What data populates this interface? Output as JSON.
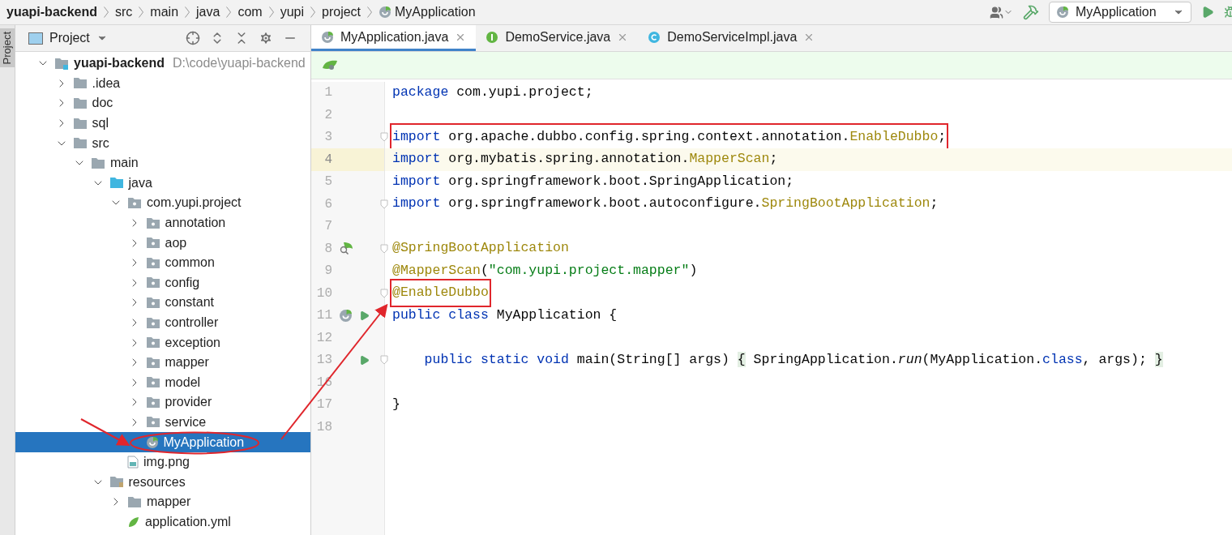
{
  "breadcrumbs": [
    "yuapi-backend",
    "src",
    "main",
    "java",
    "com",
    "yupi",
    "project",
    "MyApplication"
  ],
  "run_config": {
    "label": "MyApplication"
  },
  "side_tab": {
    "label": "Project",
    "selected": true
  },
  "project_panel": {
    "title": "Project",
    "tree": [
      {
        "label": "yuapi-backend",
        "kind": "module",
        "path": "D:\\code\\yuapi-backend",
        "expanded": true,
        "selected": false,
        "children": [
          {
            "label": ".idea",
            "kind": "folder",
            "expanded": false,
            "selected": false
          },
          {
            "label": "doc",
            "kind": "folder",
            "expanded": false,
            "selected": false
          },
          {
            "label": "sql",
            "kind": "folder",
            "expanded": false,
            "selected": false
          },
          {
            "label": "src",
            "kind": "folder",
            "expanded": true,
            "selected": false,
            "children": [
              {
                "label": "main",
                "kind": "folder",
                "expanded": true,
                "selected": false,
                "children": [
                  {
                    "label": "java",
                    "kind": "source",
                    "expanded": true,
                    "selected": false,
                    "children": [
                      {
                        "label": "com.yupi.project",
                        "kind": "package",
                        "expanded": true,
                        "selected": false,
                        "children": [
                          {
                            "label": "annotation",
                            "kind": "package",
                            "expanded": false,
                            "selected": false
                          },
                          {
                            "label": "aop",
                            "kind": "package",
                            "expanded": false,
                            "selected": false
                          },
                          {
                            "label": "common",
                            "kind": "package",
                            "expanded": false,
                            "selected": false
                          },
                          {
                            "label": "config",
                            "kind": "package",
                            "expanded": false,
                            "selected": false
                          },
                          {
                            "label": "constant",
                            "kind": "package",
                            "expanded": false,
                            "selected": false
                          },
                          {
                            "label": "controller",
                            "kind": "package",
                            "expanded": false,
                            "selected": false
                          },
                          {
                            "label": "exception",
                            "kind": "package",
                            "expanded": false,
                            "selected": false
                          },
                          {
                            "label": "mapper",
                            "kind": "package",
                            "expanded": false,
                            "selected": false
                          },
                          {
                            "label": "model",
                            "kind": "package",
                            "expanded": false,
                            "selected": false
                          },
                          {
                            "label": "provider",
                            "kind": "package",
                            "expanded": false,
                            "selected": false
                          },
                          {
                            "label": "service",
                            "kind": "package",
                            "expanded": false,
                            "selected": false
                          },
                          {
                            "label": "MyApplication",
                            "kind": "spring-class",
                            "selected": true,
                            "circled": true
                          }
                        ]
                      },
                      {
                        "label": "img.png",
                        "kind": "image",
                        "selected": false
                      }
                    ]
                  },
                  {
                    "label": "resources",
                    "kind": "resources",
                    "expanded": true,
                    "selected": false,
                    "children": [
                      {
                        "label": "mapper",
                        "kind": "folder",
                        "expanded": false,
                        "selected": false
                      },
                      {
                        "label": "application.yml",
                        "kind": "yaml",
                        "selected": false
                      }
                    ]
                  }
                ]
              }
            ]
          }
        ]
      }
    ]
  },
  "tabs": [
    {
      "label": "MyApplication.java",
      "kind": "spring-class",
      "selected": true
    },
    {
      "label": "DemoService.java",
      "kind": "interface",
      "selected": false
    },
    {
      "label": "DemoServiceImpl.java",
      "kind": "class",
      "selected": false
    }
  ],
  "code": [
    {
      "number": "1",
      "tokens": [
        {
          "text": "package",
          "kind": "kw"
        },
        {
          "text": " com.yupi.project;",
          "kind": "plain"
        }
      ]
    },
    {
      "number": "2"
    },
    {
      "number": "3",
      "fold": true,
      "boxed": true,
      "tokens": [
        {
          "text": "import",
          "kind": "kw"
        },
        {
          "text": " org.apache.dubbo.config.spring.context.annotation.",
          "kind": "plain"
        },
        {
          "text": "EnableDubbo",
          "kind": "ann"
        },
        {
          "text": ";",
          "kind": "plain"
        }
      ]
    },
    {
      "number": "4",
      "current": true,
      "tokens": [
        {
          "text": "import",
          "kind": "kw"
        },
        {
          "text": " org.mybatis.spring.annotation.",
          "kind": "plain"
        },
        {
          "text": "MapperScan",
          "kind": "ann"
        },
        {
          "text": ";",
          "kind": "plain"
        }
      ]
    },
    {
      "number": "5",
      "tokens": [
        {
          "text": "import",
          "kind": "kw"
        },
        {
          "text": " org.springframework.boot.SpringApplication;",
          "kind": "plain"
        }
      ]
    },
    {
      "number": "6",
      "fold": true,
      "tokens": [
        {
          "text": "import",
          "kind": "kw"
        },
        {
          "text": " org.springframework.boot.autoconfigure.",
          "kind": "plain"
        },
        {
          "text": "SpringBootApplication",
          "kind": "ann"
        },
        {
          "text": ";",
          "kind": "plain"
        }
      ]
    },
    {
      "number": "7"
    },
    {
      "number": "8",
      "fold": true,
      "bean_search": true,
      "tokens": [
        {
          "text": "@SpringBootApplication",
          "kind": "ann"
        }
      ]
    },
    {
      "number": "9",
      "tokens": [
        {
          "text": "@MapperScan",
          "kind": "ann"
        },
        {
          "text": "(",
          "kind": "plain"
        },
        {
          "text": "\"com.yupi.project.mapper\"",
          "kind": "str"
        },
        {
          "text": ")",
          "kind": "plain"
        }
      ]
    },
    {
      "number": "10",
      "fold": true,
      "boxed": true,
      "tokens": [
        {
          "text": "@EnableDubbo",
          "kind": "ann"
        }
      ]
    },
    {
      "number": "11",
      "bean": true,
      "run": true,
      "tokens": [
        {
          "text": "public class",
          "kind": "kw"
        },
        {
          "text": " MyApplication {",
          "kind": "plain"
        }
      ]
    },
    {
      "number": "12"
    },
    {
      "number": "13",
      "fold": true,
      "run": true,
      "tokens": [
        {
          "text": "    public static void",
          "kind": "kw"
        },
        {
          "text": " main(String[] args) ",
          "kind": "plain"
        },
        {
          "text": "{",
          "kind": "folded"
        },
        {
          "text": " SpringApplication.",
          "kind": "plain"
        },
        {
          "text": "run",
          "kind": "italic"
        },
        {
          "text": "(MyApplication.",
          "kind": "plain"
        },
        {
          "text": "class",
          "kind": "kw"
        },
        {
          "text": ", args); ",
          "kind": "plain"
        },
        {
          "text": "}",
          "kind": "folded"
        }
      ]
    },
    {
      "number": "16"
    },
    {
      "number": "17",
      "tokens": [
        {
          "text": "}",
          "kind": "plain"
        }
      ]
    },
    {
      "number": "18"
    }
  ]
}
